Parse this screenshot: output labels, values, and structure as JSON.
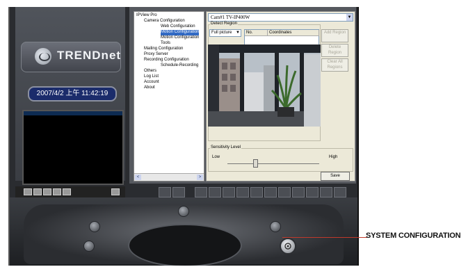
{
  "left_panel": {
    "logo_text": "TRENDnet",
    "clock": "2007/4/2 上午 11:42:19"
  },
  "tree": {
    "root": "IPView Pro",
    "items": [
      {
        "label": "Camera Configuration",
        "level": 1,
        "selected": false
      },
      {
        "label": "Web Configuration",
        "level": 2,
        "selected": false
      },
      {
        "label": "Motion Configuration",
        "level": 2,
        "selected": true
      },
      {
        "label": "Motion Configuration",
        "level": 2,
        "selected": false
      },
      {
        "label": "Tools",
        "level": 2,
        "selected": false
      },
      {
        "label": "Mailing Configuration",
        "level": 1,
        "selected": false
      },
      {
        "label": "Proxy Server",
        "level": 1,
        "selected": false
      },
      {
        "label": "Recording Configuration",
        "level": 1,
        "selected": false
      },
      {
        "label": "Schedule-Recording",
        "level": 2,
        "selected": false
      },
      {
        "label": "Others",
        "level": 1,
        "selected": false
      },
      {
        "label": "Log List",
        "level": 1,
        "selected": false
      },
      {
        "label": "Account",
        "level": 1,
        "selected": false
      },
      {
        "label": "About",
        "level": 1,
        "selected": false
      }
    ],
    "scroll_left": "<",
    "scroll_right": ">"
  },
  "config": {
    "camera_select": "Cam#1    TV-IP400W",
    "detect_region": {
      "label": "Detect Region",
      "mode": "Full picture",
      "columns": [
        "No.",
        "Coordinates"
      ],
      "buttons": [
        "Add Region",
        "Delete Region",
        "Clear All Regions"
      ]
    },
    "sensitivity": {
      "label": "Sensitivity Level",
      "low": "Low",
      "high": "High",
      "level": 0.3
    },
    "save_button": "Save"
  },
  "callout": {
    "label": "SYSTEM CONFIGURATION",
    "color": "#c0392b"
  }
}
